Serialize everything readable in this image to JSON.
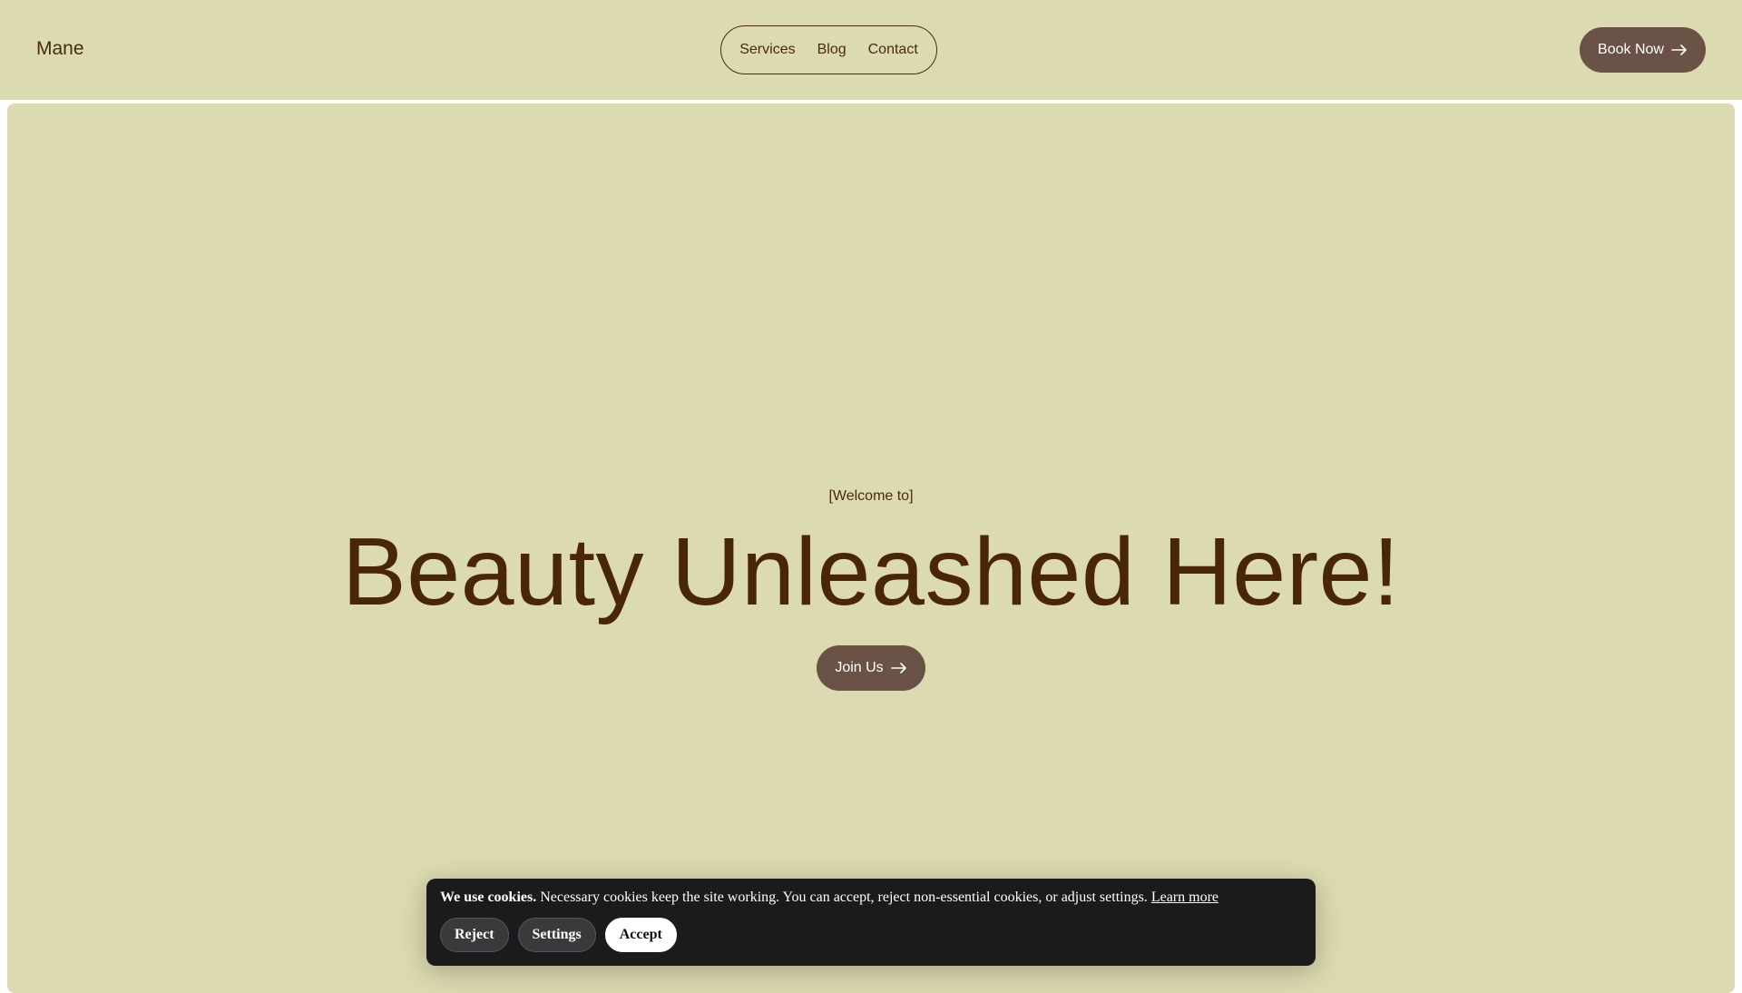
{
  "header": {
    "logo": "Mane",
    "nav": [
      "Services",
      "Blog",
      "Contact"
    ],
    "cta_label": "Book Now",
    "cta_icon": "arrow-right-icon"
  },
  "hero": {
    "eyebrow": "[Welcome to]",
    "headline": "Beauty Unleashed Here!",
    "cta_label": "Join Us",
    "cta_icon": "arrow-right-icon"
  },
  "cookie_banner": {
    "title": "We use cookies.",
    "message": "Necessary cookies keep the site working. You can accept, reject non-essential cookies, or adjust settings.",
    "link_label": "Learn more",
    "reject_label": "Reject",
    "settings_label": "Settings",
    "accept_label": "Accept"
  },
  "colors": {
    "background": "#dcdab0",
    "text": "#4a2a10",
    "button": "#6b5247",
    "banner": "#1b1b1d"
  }
}
